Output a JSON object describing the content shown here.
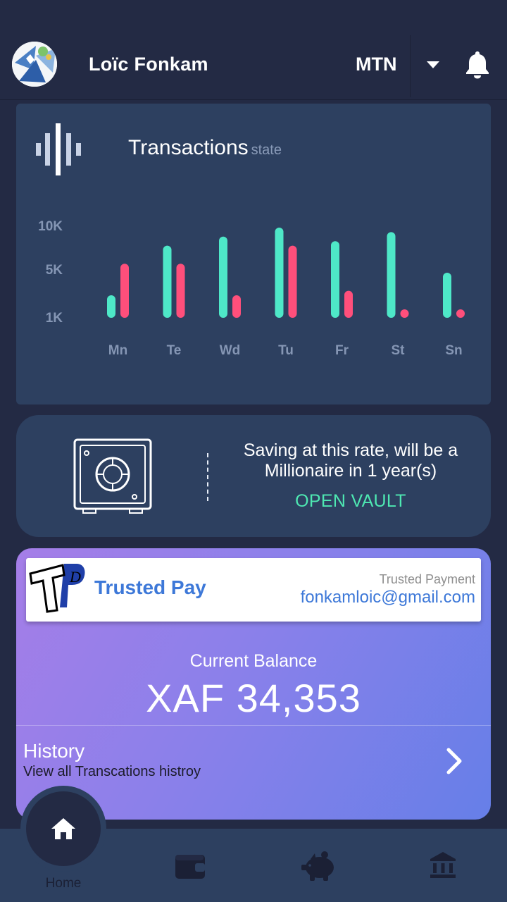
{
  "header": {
    "user_name": "Loïc Fonkam",
    "operator": "MTN"
  },
  "chart_card": {
    "title": "Transactions",
    "subtitle": "state"
  },
  "chart_data": {
    "type": "bar",
    "categories": [
      "Mn",
      "Te",
      "Wd",
      "Tu",
      "Fr",
      "St",
      "Sn"
    ],
    "y_ticks": [
      "10K",
      "5K",
      "1K"
    ],
    "series": [
      {
        "color": "#4ee8c8",
        "values": [
          2.5,
          8,
          9,
          10,
          8.5,
          9.5,
          5
        ]
      },
      {
        "color": "#ff4f7b",
        "values": [
          6,
          6,
          2.5,
          8,
          3,
          0,
          0
        ]
      }
    ],
    "ylim": [
      0,
      10
    ]
  },
  "vault": {
    "message": "Saving at this rate, will be a Millionaire in 1 year(s)",
    "link": "OPEN VAULT"
  },
  "balance_card": {
    "brand": "Trusted Pay",
    "caption": "Trusted Payment",
    "email": "fonkamloic@gmail.com",
    "balance_label": "Current Balance",
    "balance_amount": "XAF 34,353",
    "history_title": "History",
    "history_sub": "View all Transcations histroy"
  },
  "nav": {
    "home_label": "Home"
  },
  "colors": {
    "background": "#232a44",
    "card": "#2d4060",
    "accent_green": "#4ee8b2",
    "accent_pink": "#ff4f7b",
    "brand_blue": "#3d78d8"
  }
}
